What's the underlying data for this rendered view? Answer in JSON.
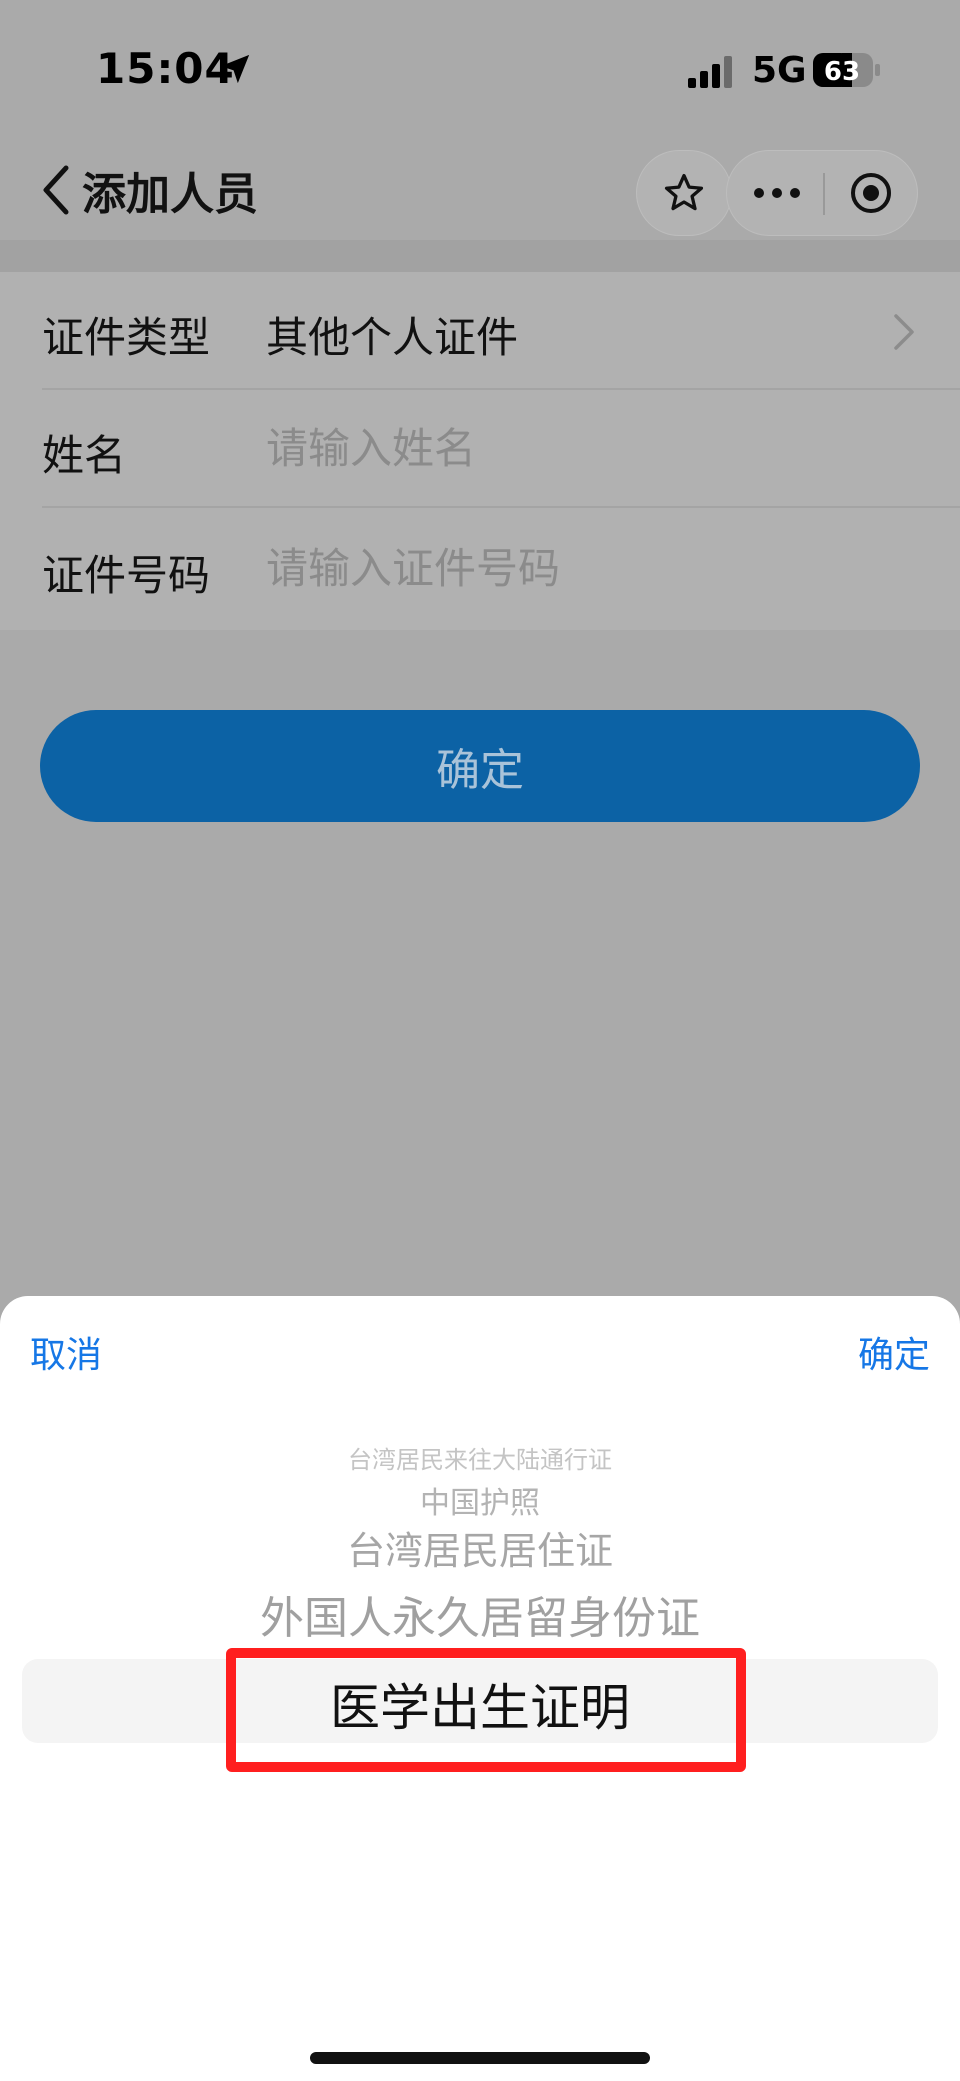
{
  "status_bar": {
    "time": "15:04",
    "network": "5G",
    "battery": "63"
  },
  "nav": {
    "title": "添加人员"
  },
  "form": {
    "id_type": {
      "label": "证件类型",
      "value": "其他个人证件"
    },
    "name": {
      "label": "姓名",
      "placeholder": "请输入姓名"
    },
    "id_number": {
      "label": "证件号码",
      "placeholder": "请输入证件号码"
    }
  },
  "confirm_label": "确定",
  "sheet": {
    "cancel": "取消",
    "ok": "确定",
    "options": [
      "台湾居民来往大陆通行证",
      "中国护照",
      "台湾居民居住证",
      "外国人永久居留身份证"
    ],
    "selected": "医学出生证明"
  }
}
